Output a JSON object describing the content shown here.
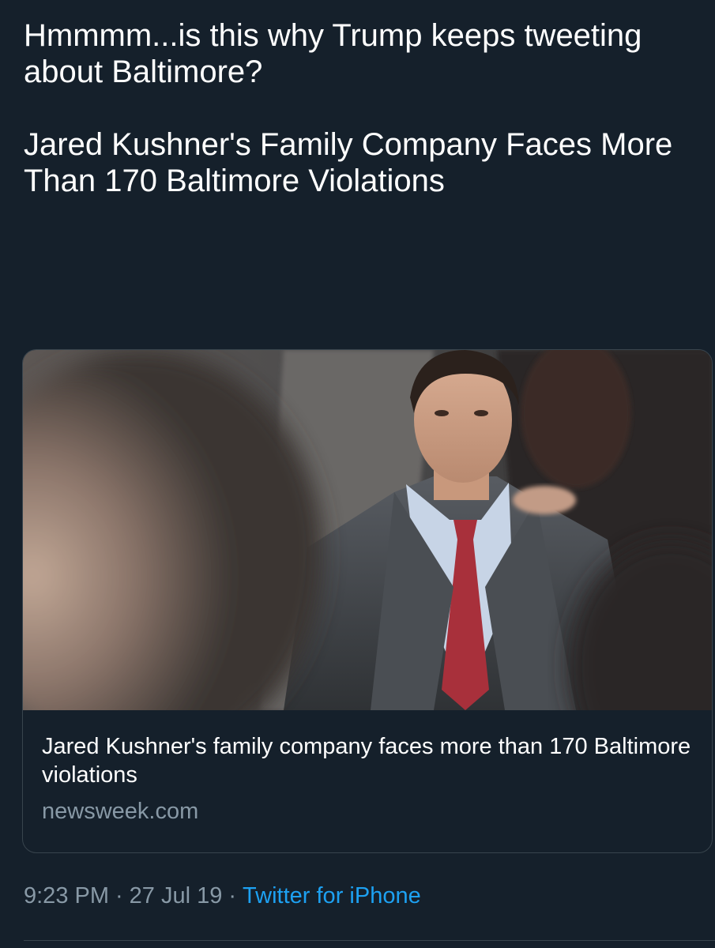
{
  "tweet": {
    "text": "Hmmmm...is this why Trump keeps tweeting about Baltimore?\n\nJared Kushner's Family Company Faces More Than 170 Baltimore Violations",
    "time": "9:23 PM",
    "date": "27 Jul 19",
    "separator": "·",
    "source": "Twitter for iPhone"
  },
  "link_card": {
    "title": "Jared Kushner's family company faces more than 170 Baltimore violations",
    "domain": "newsweek.com",
    "image": "photo of a man in a gray suit and red tie seated at a meeting"
  },
  "colors": {
    "background": "#15202b",
    "text": "#ffffff",
    "muted": "#8899a6",
    "link": "#1da1f2",
    "border": "#38444d"
  }
}
